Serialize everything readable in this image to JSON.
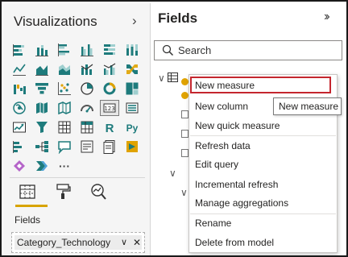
{
  "visualizations": {
    "title": "Visualizations",
    "collapse_icon": "chevron-right-icon",
    "icons": [
      "stacked-bar-chart",
      "stacked-column-chart",
      "clustered-bar-chart",
      "clustered-column-chart",
      "100-stacked-bar-chart",
      "100-stacked-column-chart",
      "line-chart",
      "area-chart",
      "stacked-area-chart",
      "line-and-column-chart",
      "line-and-clustered-column-chart",
      "ribbon-chart",
      "waterfall-chart",
      "funnel-chart",
      "scatter-chart",
      "pie-chart",
      "donut-chart",
      "treemap",
      "map",
      "filled-map",
      "shape-map",
      "gauge",
      "card",
      "multi-row-card",
      "kpi",
      "slicer",
      "table",
      "matrix",
      "r-script-visual",
      "python-visual",
      "key-influencers",
      "decomposition-tree",
      "qa-visual",
      "smart-narrative",
      "paginated-report",
      "power-apps",
      "power-automate",
      "more-visuals"
    ],
    "selected_icon": "multi-row-card",
    "more_label": "···",
    "r_label": "R",
    "py_label": "Py",
    "tabs": [
      "fields-tab-icon",
      "format-tab-icon",
      "analytics-tab-icon"
    ],
    "active_tab": "fields-tab-icon",
    "fields_label": "Fields",
    "well_value": "Category_Technology"
  },
  "fields": {
    "title": "Fields",
    "expand_icon": "double-chevron-right-icon",
    "search_placeholder": "Search"
  },
  "context_menu": {
    "items": [
      "New measure",
      "New column",
      "New quick measure",
      "Refresh data",
      "Edit query",
      "Incremental refresh",
      "Manage aggregations",
      "Rename",
      "Delete from model"
    ],
    "highlighted": "New measure"
  },
  "tooltip": "New measure",
  "colors": {
    "accent_underline": "#d8a400",
    "highlight_border": "#c4262e",
    "icon_teal": "#1e7b7c",
    "icon_amber": "#e0a300"
  }
}
